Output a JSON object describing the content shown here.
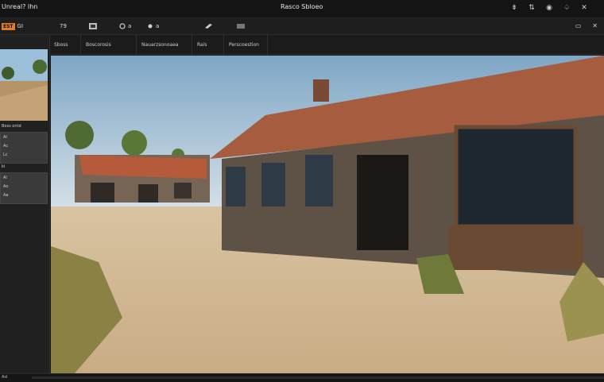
{
  "app": {
    "title": "Unreal? Ihn",
    "window_title": "Rasco Sbloeo"
  },
  "window_controls": [
    {
      "icon": "pin-icon",
      "glyph": "⇟"
    },
    {
      "icon": "sort-icon",
      "glyph": "⇅"
    },
    {
      "icon": "record-icon",
      "glyph": "◉"
    },
    {
      "icon": "bell-icon",
      "glyph": "♤"
    },
    {
      "icon": "close-icon",
      "glyph": "✕"
    }
  ],
  "toolbar": {
    "badge": "EST",
    "items": [
      {
        "label": "GI",
        "icon": "camera-icon"
      },
      {
        "label": "79",
        "icon": "grid-icon"
      },
      {
        "label": "",
        "icon": "layers-icon"
      },
      {
        "label": "a",
        "icon": "settings-icon"
      },
      {
        "label": "a",
        "icon": "eye-icon"
      },
      {
        "label": "",
        "icon": "brush-icon"
      },
      {
        "label": "",
        "icon": "wave-icon"
      }
    ],
    "end_icons": [
      "window-icon",
      "close-icon"
    ]
  },
  "tabs": [
    "Sboss",
    "Boscorosis",
    "Nauarzsonoaea",
    "Rais",
    "Perscoestion"
  ],
  "left_panel": {
    "label_top": "Boss ontd",
    "box1": [
      "Al",
      "Ac",
      "Lc"
    ],
    "label_mid": "ki",
    "box2": [
      "Al",
      "Ao",
      "Aa"
    ]
  },
  "status": {
    "text": "Asl"
  },
  "colors": {
    "accent": "#e07b2a",
    "panel": "#202020",
    "titlebar": "#141414"
  }
}
